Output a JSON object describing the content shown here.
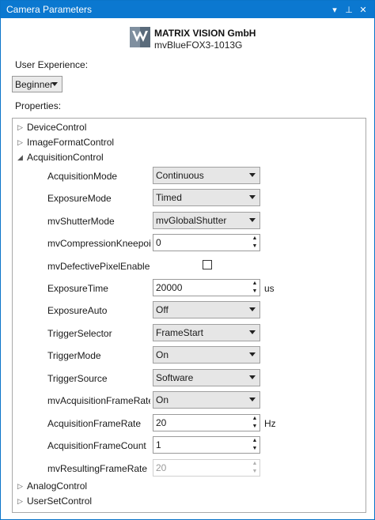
{
  "window": {
    "title": "Camera Parameters",
    "controls": {
      "menu": "▾",
      "pin": "⊥",
      "close": "✕"
    }
  },
  "header": {
    "company": "MATRIX VISION GmbH",
    "product": "mvBlueFOX3-1013G",
    "logo_icon": "matrix-vision-logo"
  },
  "user_experience": {
    "label": "User Experience:",
    "value": "Beginner"
  },
  "properties_label": "Properties:",
  "tree": {
    "nodes": [
      {
        "label": "DeviceControl",
        "expanded": false
      },
      {
        "label": "ImageFormatControl",
        "expanded": false
      },
      {
        "label": "AcquisitionControl",
        "expanded": true
      },
      {
        "label": "AnalogControl",
        "expanded": false
      },
      {
        "label": "UserSetControl",
        "expanded": false
      }
    ],
    "collapsed_glyph": "▷",
    "expanded_glyph": "◢",
    "acquisition": [
      {
        "label": "AcquisitionMode",
        "kind": "combo",
        "value": "Continuous"
      },
      {
        "label": "ExposureMode",
        "kind": "combo",
        "value": "Timed"
      },
      {
        "label": "mvShutterMode",
        "kind": "combo",
        "value": "mvGlobalShutter"
      },
      {
        "label": "mvCompressionKneepoint",
        "kind": "spin",
        "value": "0"
      },
      {
        "label": "mvDefectivePixelEnable",
        "kind": "check",
        "value": ""
      },
      {
        "label": "ExposureTime",
        "kind": "spin",
        "value": "20000",
        "unit": "us"
      },
      {
        "label": "ExposureAuto",
        "kind": "combo",
        "value": "Off"
      },
      {
        "label": "TriggerSelector",
        "kind": "combo",
        "value": "FrameStart"
      },
      {
        "label": "TriggerMode",
        "kind": "combo",
        "value": "On"
      },
      {
        "label": "TriggerSource",
        "kind": "combo",
        "value": "Software"
      },
      {
        "label": "mvAcquisitionFrameRateEr",
        "kind": "combo",
        "value": "On"
      },
      {
        "label": "AcquisitionFrameRate",
        "kind": "spin",
        "value": "20",
        "unit": "Hz"
      },
      {
        "label": "AcquisitionFrameCount",
        "kind": "spin",
        "value": "1"
      },
      {
        "label": "mvResultingFrameRate",
        "kind": "spin-disabled",
        "value": "20"
      }
    ]
  },
  "colors": {
    "titlebar": "#0b78d0",
    "combo_bg": "#e6e6e6"
  }
}
